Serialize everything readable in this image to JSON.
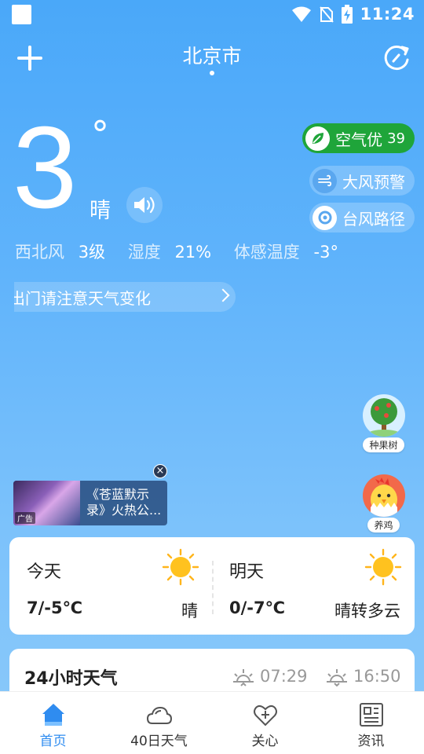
{
  "status": {
    "time": "11:24"
  },
  "header": {
    "city": "北京市"
  },
  "current": {
    "temperature": "3",
    "degree": "°",
    "condition": "晴"
  },
  "badges": {
    "aqi_label": "空气优",
    "aqi_value": "39",
    "wind_warning": "大风预警",
    "typhoon": "台风路径"
  },
  "details": {
    "wind_label": "西北风",
    "wind_value": "3级",
    "humidity_label": "湿度",
    "humidity_value": "21%",
    "feels_label": "体感温度",
    "feels_value": "-3°"
  },
  "notice": {
    "text": "出门请注意天气变化"
  },
  "side": {
    "tree_label": "种果树",
    "chicken_label": "养鸡"
  },
  "ad": {
    "tag": "广告",
    "text": "《苍蓝默示录》火热公..."
  },
  "forecast": {
    "today": {
      "day": "今天",
      "temp": "7/-5℃",
      "condition": "晴"
    },
    "tomorrow": {
      "day": "明天",
      "temp": "0/-7℃",
      "condition": "晴转多云"
    }
  },
  "hourly": {
    "title": "24小时天气",
    "sunrise": "07:29",
    "sunset": "16:50"
  },
  "nav": {
    "items": [
      {
        "label": "首页",
        "icon": "home-icon",
        "active": true
      },
      {
        "label": "40日天气",
        "icon": "cloud-icon",
        "active": false
      },
      {
        "label": "关心",
        "icon": "heart-icon",
        "active": false
      },
      {
        "label": "资讯",
        "icon": "news-icon",
        "active": false
      }
    ]
  },
  "colors": {
    "accent": "#2f8cf0",
    "aqi_green": "#1fa53a"
  }
}
